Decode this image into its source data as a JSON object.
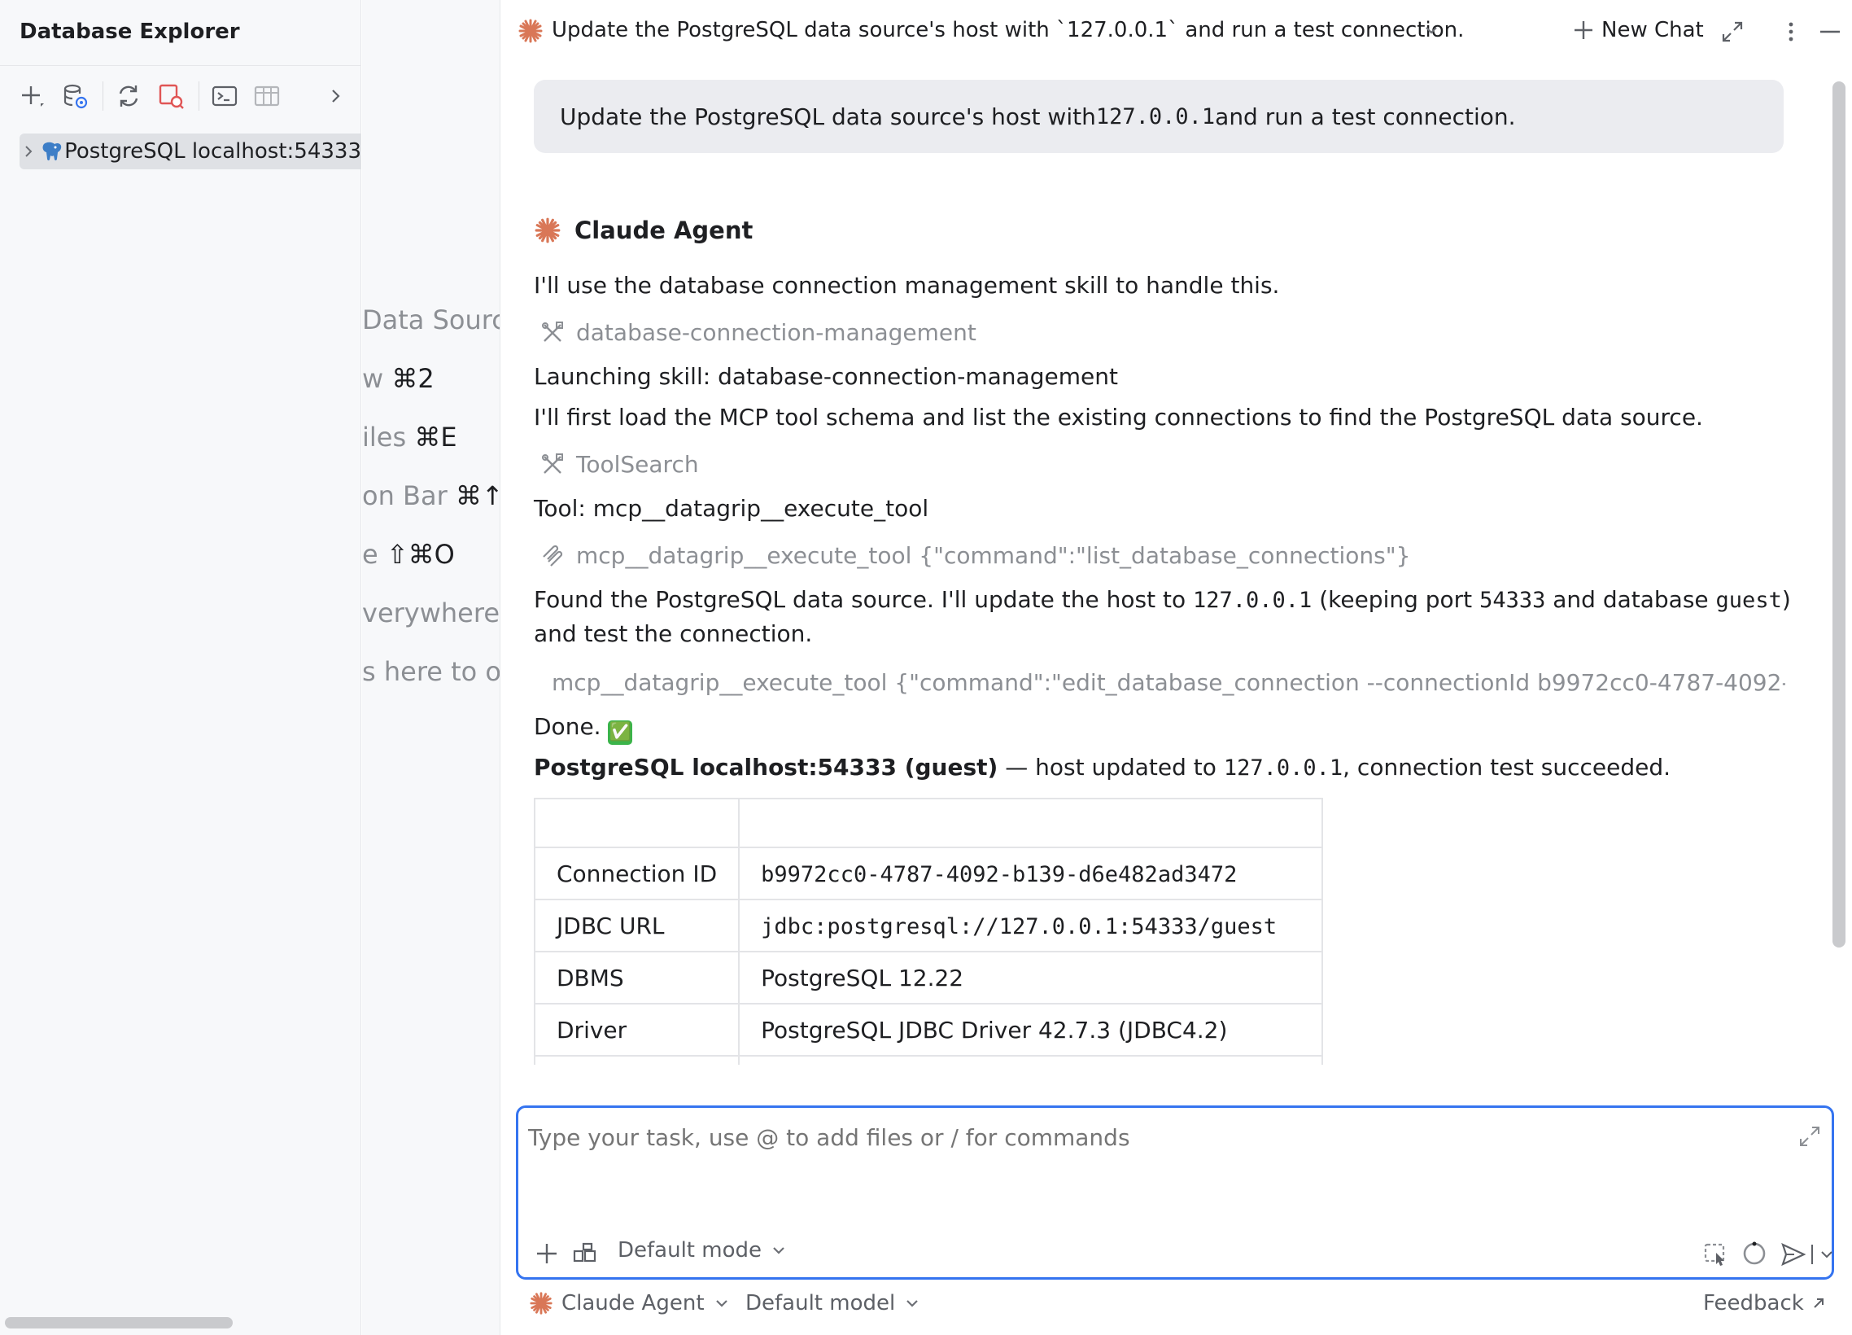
{
  "sidebar": {
    "title": "Database Explorer",
    "tree": [
      {
        "label": "PostgreSQL localhost:54333",
        "icon": "postgresql-elephant-icon",
        "expanded": false
      }
    ]
  },
  "empty_panel": {
    "hints": [
      {
        "prefix": "Data Sourc",
        "shortcut": ""
      },
      {
        "prefix": "w ",
        "shortcut": "⌘2"
      },
      {
        "prefix": "iles ",
        "shortcut": "⌘E"
      },
      {
        "prefix": "on Bar ",
        "shortcut": "⌘↑"
      },
      {
        "prefix": "e ",
        "shortcut": "⇧⌘O"
      },
      {
        "prefix": "verywhere",
        "shortcut": ""
      },
      {
        "prefix": "s here to op",
        "shortcut": ""
      }
    ]
  },
  "header": {
    "title": "Update the PostgreSQL data source's host with `127.0.0.1` and run a test connection.",
    "new_chat": "New Chat"
  },
  "chat": {
    "user_message": {
      "before": "Update the PostgreSQL data source's host with ",
      "code": "127.0.0.1",
      "after": " and run a test connection."
    },
    "agent_name": "Claude Agent",
    "text_skill_intro": "I'll use the database connection management skill to handle this.",
    "tool_skill": "database-connection-management",
    "text_launching": "Launching skill: database-connection-management",
    "text_load_schema": "I'll first load the MCP tool schema and list the existing connections to find the PostgreSQL data source.",
    "tool_search": "ToolSearch",
    "text_tool": "Tool: mcp__datagrip__execute_tool",
    "tool_call_list": "mcp__datagrip__execute_tool {\"command\":\"list_database_connections\"}",
    "found": {
      "p1": "Found the PostgreSQL data source. I'll update the host to ",
      "c1": "127.0.0.1",
      "p2": " (keeping port ",
      "c2": "54333",
      "p3": " and database ",
      "c3": "guest",
      "p4": ")",
      "line2": "and test the connection."
    },
    "tool_call_edit": "mcp__datagrip__execute_tool {\"command\":\"edit_database_connection --connectionId b9972cc0-4787-4092-",
    "done_text": "Done.",
    "done_emoji": "✅",
    "summary": {
      "bold": "PostgreSQL localhost:54333 (guest)",
      "p1": " — host updated to ",
      "code": "127.0.0.1",
      "p2": ", connection test succeeded."
    },
    "table": {
      "rows": [
        {
          "key": "Connection ID",
          "value": "b9972cc0-4787-4092-b139-d6e482ad3472",
          "mono": true
        },
        {
          "key": "JDBC URL",
          "value": "jdbc:postgresql://127.0.0.1:54333/guest",
          "mono": true
        },
        {
          "key": "DBMS",
          "value": "PostgreSQL 12.22",
          "mono": false
        },
        {
          "key": "Driver",
          "value": "PostgreSQL JDBC Driver 42.7.3 (JDBC4.2)",
          "mono": false
        }
      ]
    }
  },
  "input": {
    "placeholder": "Type your task, use @ to add files or / for commands",
    "mode": "Default mode"
  },
  "footer": {
    "agent": "Claude Agent",
    "model": "Default model",
    "feedback": "Feedback"
  },
  "colors": {
    "accent": "#3574f0",
    "claude": "#d97757",
    "muted": "#8c8f94",
    "sidebar_bg": "#f7f8fa",
    "user_bubble": "#ebecf0"
  }
}
